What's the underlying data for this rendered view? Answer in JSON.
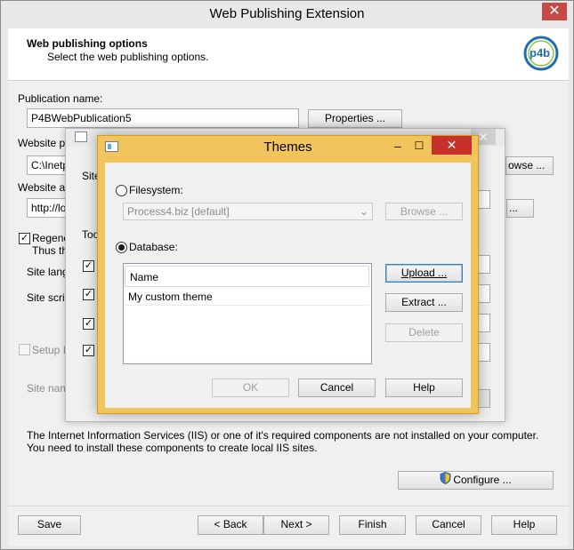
{
  "window": {
    "title": "Web Publishing Extension",
    "close_glyph": "✕"
  },
  "banner": {
    "title": "Web publishing options",
    "subtitle": "Select the web publishing options.",
    "logo_text": "p4b"
  },
  "form": {
    "publication_name_label": "Publication name:",
    "publication_name_value": "P4BWebPublication5",
    "properties_button": "Properties ...",
    "website_path_label": "Website pa",
    "website_path_value": "C:\\Inetp",
    "browse_button_1": "owse ...",
    "website_address_label": "Website ad",
    "website_address_value": "http://loc",
    "browse_button_2": "...",
    "regenerate_label_1": "Regene",
    "regenerate_label_2": "Thus the",
    "site_language_label": "Site langu",
    "site_script_label": "Site script",
    "setup_iis_label": "Setup IIS",
    "site_name_label": "Site name",
    "iis_notice": "The Internet Information Services (IIS) or one of it's required components are not installed on your computer. You need to install these components to create local IIS sites.",
    "configure_button": "Configure ..."
  },
  "mid_dialog": {
    "label_site": "Site",
    "label_tools": "Too"
  },
  "footer": {
    "save": "Save",
    "back": "< Back",
    "next": "Next >",
    "finish": "Finish",
    "cancel": "Cancel",
    "help": "Help"
  },
  "themes": {
    "title": "Themes",
    "filesystem_label": "Filesystem:",
    "filesystem_combo_value": "Process4.biz [default]",
    "browse_button": "Browse ...",
    "database_label": "Database:",
    "list_header": "Name",
    "list_items": [
      "My custom theme"
    ],
    "upload_button": "Upload ...",
    "extract_button": "Extract ...",
    "delete_button": "Delete",
    "ok_button": "OK",
    "cancel_button": "Cancel",
    "help_button": "Help"
  },
  "colors": {
    "themes_frame": "#f2c55c",
    "close_red": "#c7312a",
    "logo_blue": "#1f6fa8",
    "logo_green": "#8cc63f"
  }
}
